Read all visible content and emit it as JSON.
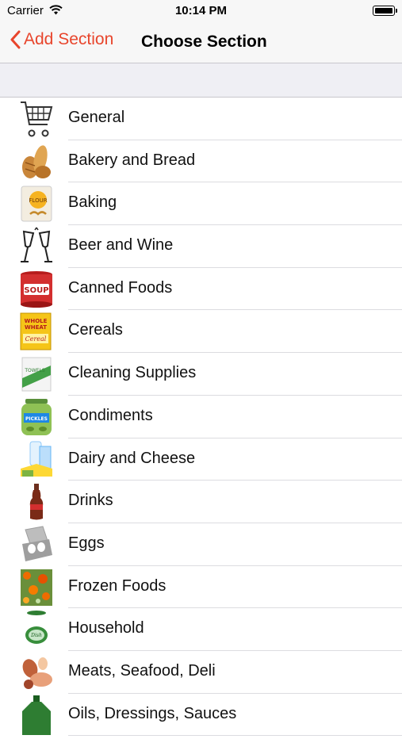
{
  "status_bar": {
    "carrier": "Carrier",
    "time": "10:14 PM"
  },
  "nav": {
    "back_label": "Add Section",
    "title": "Choose Section"
  },
  "colors": {
    "accent": "#e8452c",
    "header_bg": "#efeff4",
    "bar_bg": "#f7f7f7"
  },
  "sections": [
    {
      "label": "General",
      "icon": "shopping-cart-icon"
    },
    {
      "label": "Bakery and Bread",
      "icon": "bread-icon"
    },
    {
      "label": "Baking",
      "icon": "flour-bag-icon"
    },
    {
      "label": "Beer and Wine",
      "icon": "wine-glasses-icon"
    },
    {
      "label": "Canned Foods",
      "icon": "soup-can-icon"
    },
    {
      "label": "Cereals",
      "icon": "cereal-box-icon"
    },
    {
      "label": "Cleaning Supplies",
      "icon": "paper-towels-icon"
    },
    {
      "label": "Condiments",
      "icon": "pickles-jar-icon"
    },
    {
      "label": "Dairy and Cheese",
      "icon": "dairy-icon"
    },
    {
      "label": "Drinks",
      "icon": "soda-bottle-icon"
    },
    {
      "label": "Eggs",
      "icon": "egg-carton-icon"
    },
    {
      "label": "Frozen Foods",
      "icon": "frozen-vegetables-icon"
    },
    {
      "label": "Household",
      "icon": "household-can-icon"
    },
    {
      "label": "Meats, Seafood, Deli",
      "icon": "meats-icon"
    },
    {
      "label": "Oils, Dressings, Sauces",
      "icon": "oil-bottle-icon"
    }
  ]
}
